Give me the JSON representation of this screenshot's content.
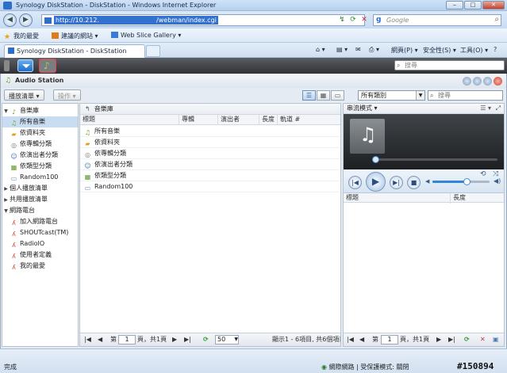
{
  "browser": {
    "window_title": "Synology DiskStation - DiskStation - Windows Internet Explorer",
    "address_url": "http://10.212.         /webman/index.cgi",
    "search_placeholder": "Google",
    "favorites_label": "我的最愛",
    "suggested_sites_label": "建議的網站 ▾",
    "web_slice_label": "Web Slice Gallery ▾",
    "tab_title": "Synology DiskStation - DiskStation",
    "cmd_page": "網頁(P) ▾",
    "cmd_safety": "安全性(S) ▾",
    "cmd_tools": "工具(O) ▾",
    "status_done": "完成",
    "status_zone": "網際網路 | 受保護模式: 關閉",
    "watermark": "#150894"
  },
  "diskstation": {
    "search_placeholder": "搜尋"
  },
  "audio_station": {
    "title": "Audio Station",
    "toolbar": {
      "playlist_btn": "播放清單 ▾",
      "action_btn": "操作 ▾",
      "category_select": "所有類別",
      "search_placeholder": "搜尋"
    },
    "sidebar": [
      {
        "label": "音樂庫",
        "icon": "library-icon",
        "level": 0,
        "expanded": true
      },
      {
        "label": "所有音樂",
        "icon": "music-note-icon",
        "level": 1,
        "selected": true
      },
      {
        "label": "依資料夾",
        "icon": "folder-icon",
        "level": 1
      },
      {
        "label": "依專輯分類",
        "icon": "album-icon",
        "level": 1
      },
      {
        "label": "依演出者分類",
        "icon": "artist-icon",
        "level": 1
      },
      {
        "label": "依類型分類",
        "icon": "genre-icon",
        "level": 1
      },
      {
        "label": "Random100",
        "icon": "random-icon",
        "level": 1
      },
      {
        "label": "個人播放清單",
        "icon": "",
        "level": 0,
        "expanded": false
      },
      {
        "label": "共用播放清單",
        "icon": "",
        "level": 0,
        "expanded": false
      },
      {
        "label": "網路電台",
        "icon": "",
        "level": 0,
        "expanded": true
      },
      {
        "label": "加入網路電台",
        "icon": "radio-icon",
        "level": 1
      },
      {
        "label": "SHOUTcast(TM)",
        "icon": "radio-icon",
        "level": 1
      },
      {
        "label": "RadioIO",
        "icon": "radio-icon",
        "level": 1
      },
      {
        "label": "使用者定義",
        "icon": "radio-icon",
        "level": 1
      },
      {
        "label": "我的最愛",
        "icon": "radio-icon",
        "level": 1
      }
    ],
    "list": {
      "breadcrumb": "音樂庫",
      "columns": [
        "標題",
        "專輯",
        "演出者",
        "長度",
        "軌道 #"
      ],
      "rows": [
        {
          "label": "所有音樂",
          "icon": "music-note-icon"
        },
        {
          "label": "依資料夾",
          "icon": "folder-icon"
        },
        {
          "label": "依專輯分類",
          "icon": "album-icon"
        },
        {
          "label": "依演出者分類",
          "icon": "artist-icon"
        },
        {
          "label": "依類型分類",
          "icon": "genre-icon"
        },
        {
          "label": "Random100",
          "icon": "random-icon"
        }
      ],
      "pager": {
        "page_prefix": "第",
        "page_value": "1",
        "page_suffix": "頁，共1頁",
        "page_size": "50",
        "summary": "顯示1 - 6項目, 共6個項目"
      }
    },
    "player": {
      "mode_label": "串流模式 ▾",
      "progress_fraction": 0.0,
      "volume_fraction": 0.6,
      "columns": [
        "標題",
        "長度"
      ],
      "pager": {
        "page_prefix": "第",
        "page_value": "1",
        "page_suffix": "頁，共1頁"
      }
    }
  }
}
